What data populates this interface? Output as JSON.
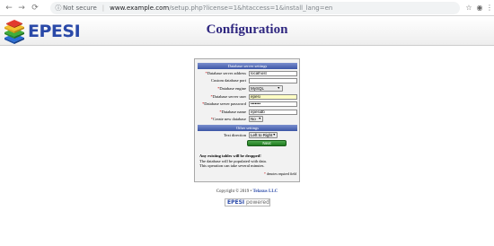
{
  "browser": {
    "security_label": "Not secure",
    "url_host": "www.example.com",
    "url_path": "/setup.php?license=1&htaccess=1&install_lang=en"
  },
  "header": {
    "logo_text": "EPESI",
    "title": "Configuration"
  },
  "form": {
    "db_section_title": "Database server settings",
    "fields": [
      {
        "label": "Database server address",
        "value": "localhost",
        "required": true
      },
      {
        "label": "Custom database port",
        "value": "",
        "required": false
      },
      {
        "label": "Database engine",
        "value": "MySQL",
        "required": true
      },
      {
        "label": "Database server user",
        "value": "epesi",
        "required": true
      },
      {
        "label": "Database server password",
        "value": "•••••••",
        "required": true
      },
      {
        "label": "Database name",
        "value": "epesidb",
        "required": true
      },
      {
        "label": "Create new database",
        "value": "No",
        "required": true
      }
    ],
    "other_section_title": "Other settings",
    "text_direction_label": "Text direction",
    "text_direction_value": "Left to Right",
    "next_label": "Next",
    "warning": "Any existing tables will be dropped!",
    "note1": "The database will be populated with data.",
    "note2": "This operation can take several minutes.",
    "required_note": "denotes required field"
  },
  "footer": {
    "copyright_prefix": "Copyright © 2019 •",
    "company": "Telaxus LLC",
    "powered_brand": "EPESI",
    "powered_suffix": "powered"
  }
}
